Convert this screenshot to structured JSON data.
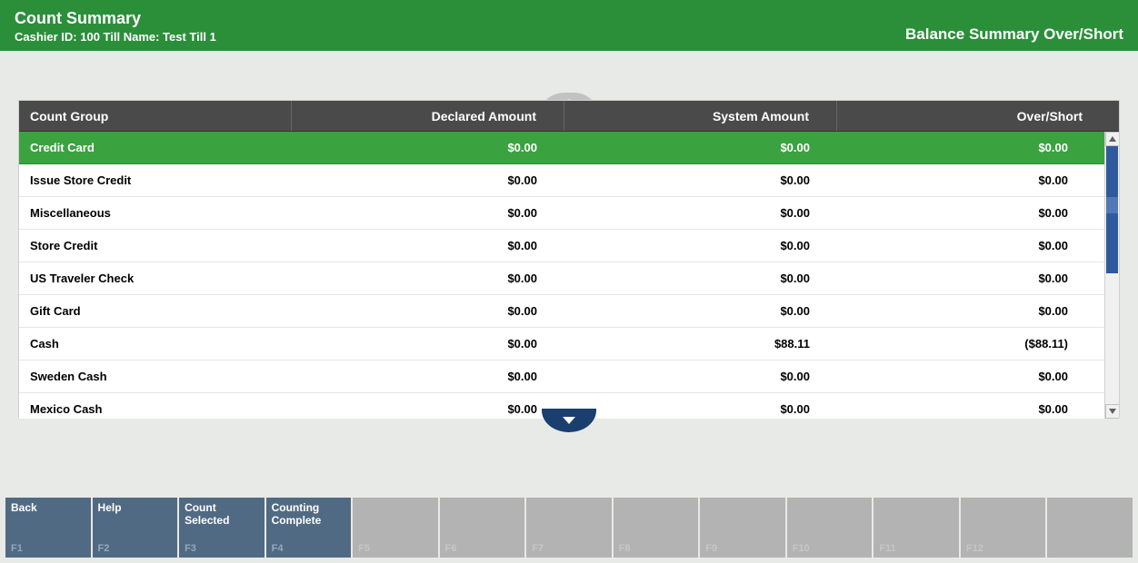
{
  "header": {
    "title": "Count Summary",
    "subtitle": "Cashier ID:  100  Till Name:  Test Till 1",
    "right": "Balance Summary Over/Short"
  },
  "columns": {
    "group": "Count Group",
    "declared": "Declared Amount",
    "system": "System Amount",
    "overShort": "Over/Short"
  },
  "rows": [
    {
      "group": "Credit Card",
      "declared": "$0.00",
      "system": "$0.00",
      "overShort": "$0.00",
      "selected": true
    },
    {
      "group": "Issue Store Credit",
      "declared": "$0.00",
      "system": "$0.00",
      "overShort": "$0.00",
      "selected": false
    },
    {
      "group": "Miscellaneous",
      "declared": "$0.00",
      "system": "$0.00",
      "overShort": "$0.00",
      "selected": false
    },
    {
      "group": "Store Credit",
      "declared": "$0.00",
      "system": "$0.00",
      "overShort": "$0.00",
      "selected": false
    },
    {
      "group": "US Traveler Check",
      "declared": "$0.00",
      "system": "$0.00",
      "overShort": "$0.00",
      "selected": false
    },
    {
      "group": "Gift Card",
      "declared": "$0.00",
      "system": "$0.00",
      "overShort": "$0.00",
      "selected": false
    },
    {
      "group": "Cash",
      "declared": "$0.00",
      "system": "$88.11",
      "overShort": "($88.11)",
      "selected": false
    },
    {
      "group": "Sweden Cash",
      "declared": "$0.00",
      "system": "$0.00",
      "overShort": "$0.00",
      "selected": false
    },
    {
      "group": "Mexico Cash",
      "declared": "$0.00",
      "system": "$0.00",
      "overShort": "$0.00",
      "selected": false
    }
  ],
  "footer": [
    {
      "label": "Back",
      "num": "F1",
      "active": true
    },
    {
      "label": "Help",
      "num": "F2",
      "active": true
    },
    {
      "label": "Count Selected",
      "num": "F3",
      "active": true
    },
    {
      "label": "Counting Complete",
      "num": "F4",
      "active": true
    },
    {
      "label": "",
      "num": "F5",
      "active": false
    },
    {
      "label": "",
      "num": "F6",
      "active": false
    },
    {
      "label": "",
      "num": "F7",
      "active": false
    },
    {
      "label": "",
      "num": "F8",
      "active": false
    },
    {
      "label": "",
      "num": "F9",
      "active": false
    },
    {
      "label": "",
      "num": "F10",
      "active": false
    },
    {
      "label": "",
      "num": "F11",
      "active": false
    },
    {
      "label": "",
      "num": "F12",
      "active": false
    },
    {
      "label": "",
      "num": "",
      "active": false
    }
  ]
}
